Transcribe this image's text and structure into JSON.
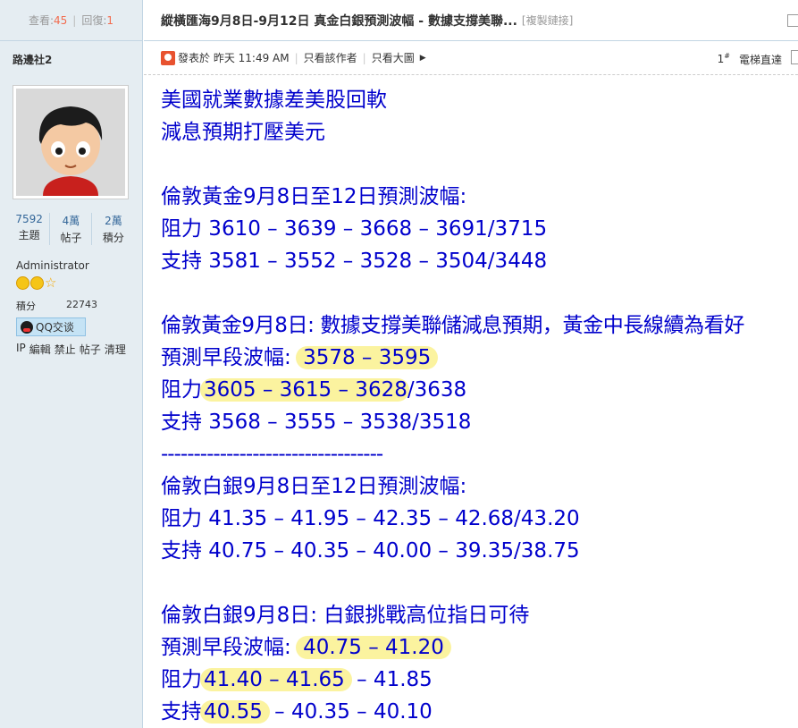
{
  "stats": {
    "views_label": "查看:",
    "views": "45",
    "replies_label": "回復:",
    "replies": "1"
  },
  "thread": {
    "title": "縱橫匯海9月8日-9月12日 真金白銀預測波幅 - 數據支撐美聯...",
    "copy_link": "[複製鏈接]"
  },
  "author": {
    "name": "路邊社2",
    "topics": "7592",
    "topics_label": "主題",
    "posts": "4萬",
    "posts_label": "帖子",
    "points_k": "2萬",
    "points_k_label": "積分",
    "role": "Administrator",
    "points_label": "積分",
    "points": "22743",
    "qq_label": "QQ交谈",
    "admin_links": [
      "IP",
      "編輯",
      "禁止",
      "帖子",
      "清理"
    ]
  },
  "meta": {
    "posted": "發表於 昨天 11:49 AM",
    "only_author": "只看該作者",
    "large_image": "只看大圖",
    "floor": "1",
    "floor_sup": "#",
    "jump": "電梯直達"
  },
  "post": {
    "l1": "美國就業數據差美股回軟",
    "l2": "減息預期打壓美元",
    "l3": "倫敦黃金9月8日至12日預測波幅:",
    "l4": "阻力 3610 – 3639 – 3668 – 3691/3715",
    "l5": "支持 3581 – 3552 – 3528 – 3504/3448",
    "l6": "倫敦黃金9月8日:  數據支撐美聯儲減息預期，黃金中長線續為看好",
    "l7a": "預測早段波幅:",
    "l7b": "3578 – 3595",
    "l8a": "阻力",
    "l8b": "3605 – 3615 – 3628",
    "l8c": "/3638",
    "l9": "支持 3568 – 3555 – 3538/3518",
    "l10": "----------------------------------",
    "l11": "倫敦白銀9月8日至12日預測波幅:",
    "l12": "阻力 41.35 – 41.95 – 42.35 – 42.68/43.20",
    "l13": "支持 40.75 – 40.35 – 40.00 – 39.35/38.75",
    "l14": "倫敦白銀9月8日:  白銀挑戰高位指日可待",
    "l15a": "預測早段波幅:",
    "l15b": "40.75 – 41.20",
    "l16a": "阻力",
    "l16b": "41.40 – 41.65",
    "l16c": "– 41.85",
    "l17a": "支持",
    "l17b": "40.55",
    "l17c": "– 40.35 – 40.10"
  },
  "colors": {
    "post_text": "#0000cc",
    "highlight": "#fbf39f",
    "sidebar_bg": "#e5edf2"
  }
}
